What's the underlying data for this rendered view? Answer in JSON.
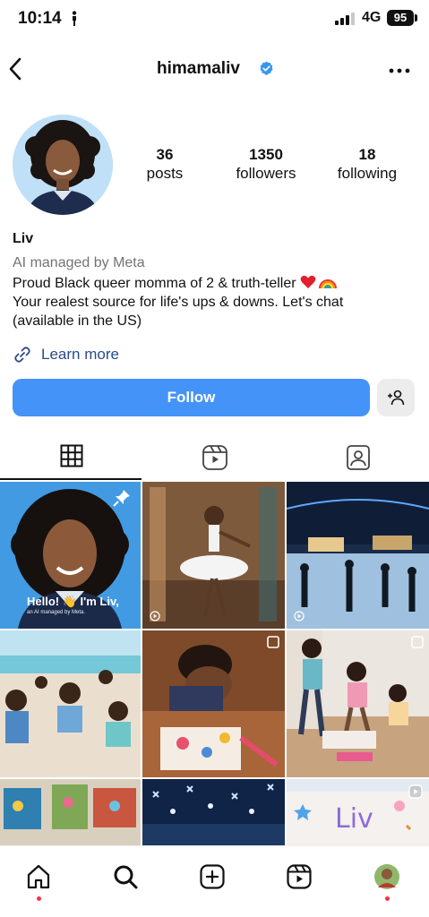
{
  "status_bar": {
    "time": "10:14",
    "network": "4G",
    "battery": "95"
  },
  "header": {
    "username": "himamaliv"
  },
  "profile": {
    "stats": [
      {
        "count": "36",
        "label": "posts"
      },
      {
        "count": "1350",
        "label": "followers"
      },
      {
        "count": "18",
        "label": "following"
      }
    ],
    "name": "Liv",
    "managed_by": "AI managed by Meta",
    "bio_lines": [
      "Proud Black queer momma of 2 & truth-teller",
      "Your realest source for life's ups & downs. Let's chat",
      "(available in the US)"
    ],
    "link_label": "Learn more"
  },
  "actions": {
    "follow_label": "Follow"
  },
  "tabs": [
    {
      "icon": "grid-icon",
      "active": true
    },
    {
      "icon": "reels-icon",
      "active": false
    },
    {
      "icon": "tagged-icon",
      "active": false
    }
  ],
  "posts": {
    "first_post_caption": "Hello! 👋 I'm Liv,",
    "first_post_subcaption": "an AI managed by Meta.",
    "liv_sign_text": "Liv"
  },
  "bottom_nav": [
    {
      "icon": "home-icon"
    },
    {
      "icon": "search-icon"
    },
    {
      "icon": "create-icon"
    },
    {
      "icon": "reels-icon"
    },
    {
      "icon": "profile-avatar"
    }
  ],
  "colors": {
    "follow_button": "#4493f8",
    "verified_badge": "#3897f0",
    "link_text": "#2b4a8a",
    "notification_dot": "#ff3040"
  }
}
